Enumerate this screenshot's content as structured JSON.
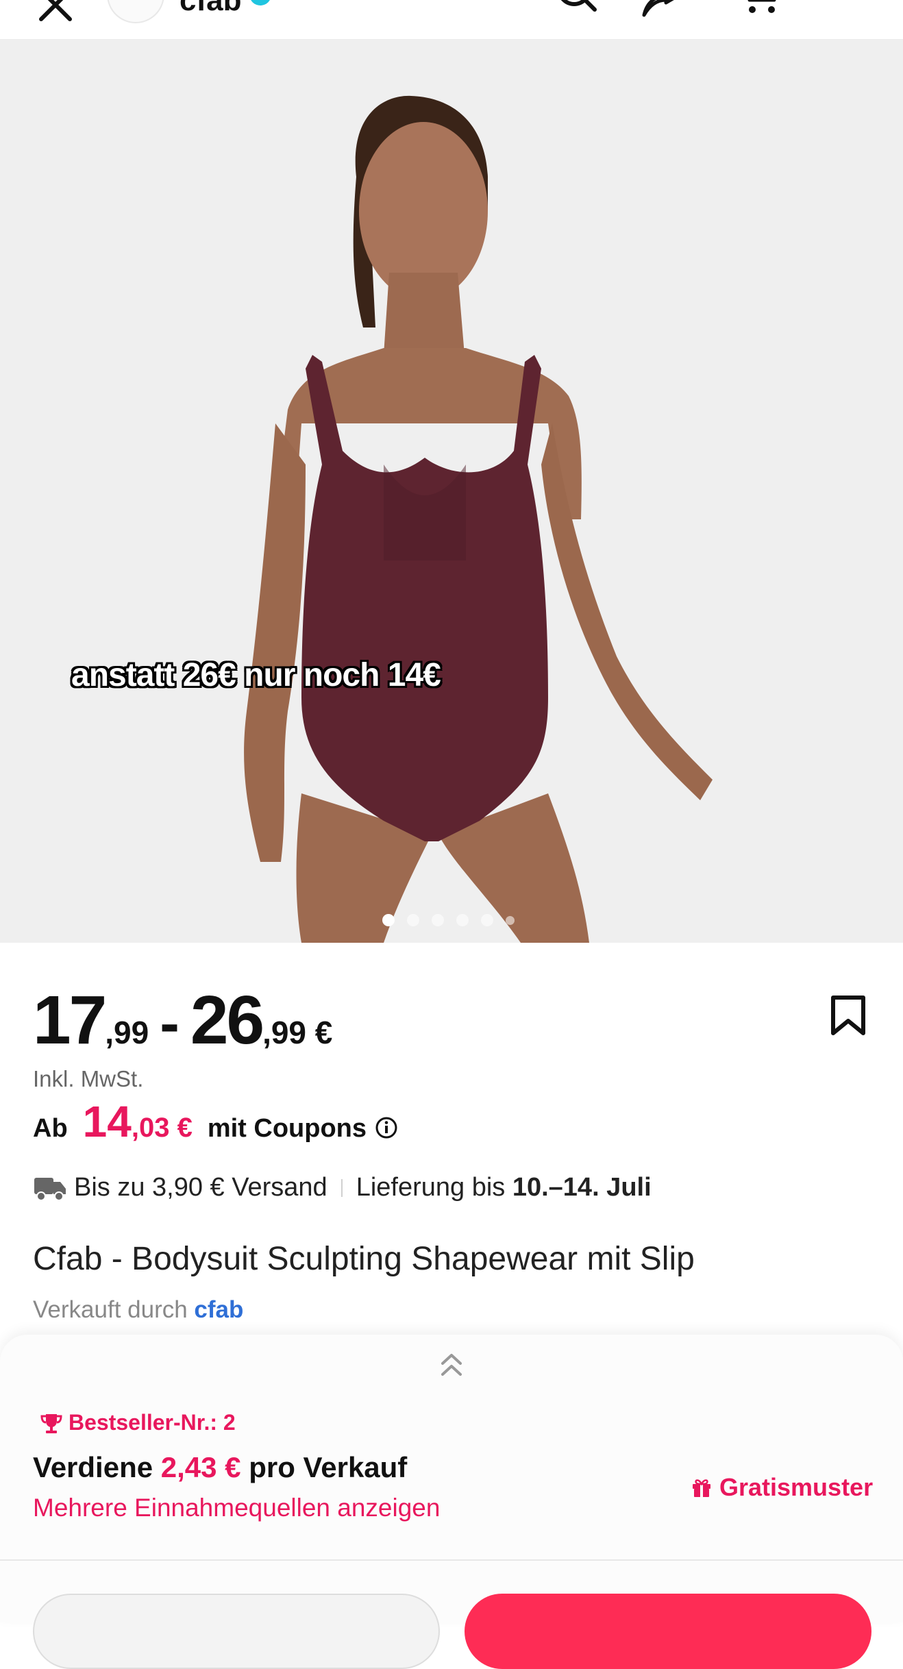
{
  "header": {
    "shop_name": "cfab",
    "icons": [
      "close-icon",
      "search-icon",
      "share-icon",
      "cart-icon"
    ]
  },
  "gallery": {
    "overlay_text": "anstatt 26€ nur noch 14€",
    "dot_count": 6,
    "active_dot": 1
  },
  "price": {
    "min_whole": "17",
    "min_cents": ",99",
    "separator": "-",
    "max_whole": "26",
    "max_cents": ",99 €",
    "vat_note": "Inkl. MwSt."
  },
  "coupon": {
    "prefix": "Ab",
    "price_whole": "14",
    "price_cents": ",03 €",
    "suffix": "mit Coupons"
  },
  "shipping": {
    "text": "Bis zu 3,90 € Versand",
    "delivery_prefix": "Lieferung bis ",
    "delivery_dates": "10.–14. Juli"
  },
  "product": {
    "title": "Cfab - Bodysuit Sculpting Shapewear mit Slip",
    "seller_prefix": "Verkauft durch ",
    "seller_name": "cfab"
  },
  "sheet": {
    "bestseller": "Bestseller-Nr.: 2",
    "earn_prefix": "Verdiene ",
    "earn_amount": "2,43 €",
    "earn_suffix": " pro Verkauf",
    "more_income": "Mehrere Einnahmequellen anzeigen",
    "free_sample": "Gratismuster"
  },
  "colors": {
    "accent_pink": "#e8175d",
    "link_blue": "#2f6fd6",
    "garment": "#5e2430",
    "cta_red": "#fe2c55"
  }
}
